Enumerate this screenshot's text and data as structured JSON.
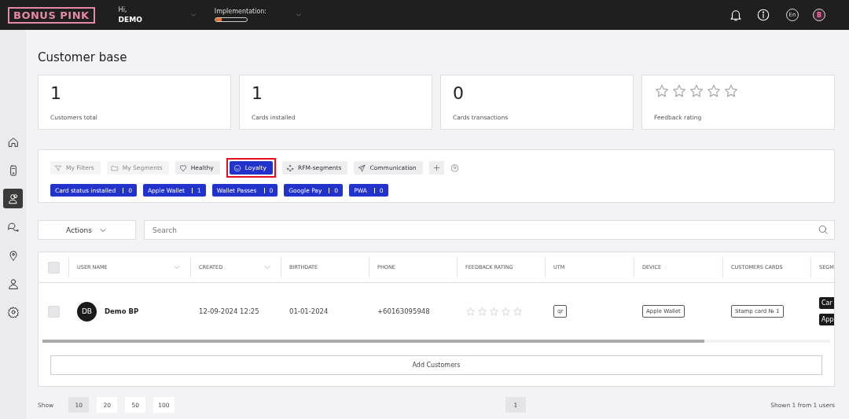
{
  "topbar": {
    "logo": "BONUS PINK",
    "greeting": "Hi,",
    "user": "DEMO",
    "implementation": {
      "label": "Implementation:",
      "level": 0.2
    },
    "language": "En",
    "avatar": "B"
  },
  "sidebar": {
    "items": [
      {
        "selected": false
      },
      {
        "selected": false
      },
      {
        "selected": true
      },
      {
        "selected": false
      },
      {
        "selected": false
      },
      {
        "selected": false
      },
      {
        "selected": false
      }
    ]
  },
  "page_title": "Customer base",
  "stats": [
    {
      "kind": "number",
      "value": "1",
      "label": "Customers total"
    },
    {
      "kind": "number",
      "value": "1",
      "label": "Cards installed"
    },
    {
      "kind": "number",
      "value": "0",
      "label": "Cards transactions"
    },
    {
      "kind": "stars",
      "stars": 0,
      "label": "Feedback rating"
    }
  ],
  "filter_tabs": [
    {
      "label": "My Filters",
      "disabled": true,
      "selected": false,
      "highlighted": false
    },
    {
      "label": "My Segments",
      "disabled": true,
      "selected": false,
      "highlighted": false
    },
    {
      "label": "Healthy",
      "disabled": false,
      "selected": false,
      "highlighted": false
    },
    {
      "label": "Loyalty",
      "disabled": false,
      "selected": true,
      "highlighted": true
    },
    {
      "label": "RFM-segments",
      "disabled": false,
      "selected": false,
      "highlighted": false
    },
    {
      "label": "Communication",
      "disabled": false,
      "selected": false,
      "highlighted": false
    }
  ],
  "chips": [
    {
      "label": "Card status installed",
      "count": "0"
    },
    {
      "label": "Apple Wallet",
      "count": "1"
    },
    {
      "label": "Wallet Passes",
      "count": "0"
    },
    {
      "label": "Google Pay",
      "count": "0"
    },
    {
      "label": "PWA",
      "count": "0"
    }
  ],
  "actions": "Actions",
  "search": {
    "placeholder": "Search"
  },
  "table": {
    "select_all_checked": false,
    "columns": [
      {
        "label": "USER NAME",
        "sortable": true
      },
      {
        "label": "CREATED",
        "sortable": true
      },
      {
        "label": "BIRTHDATE",
        "sortable": false
      },
      {
        "label": "PHONE",
        "sortable": false
      },
      {
        "label": "FEEDBACK RATING",
        "sortable": false
      },
      {
        "label": "UTM",
        "sortable": false
      },
      {
        "label": "DEVICE",
        "sortable": false
      },
      {
        "label": "CUSTOMERS CARDS",
        "sortable": false
      },
      {
        "label": "SEGM"
      }
    ],
    "rows": [
      {
        "checked": false,
        "initials": "DB",
        "name": "Demo BP",
        "created": "12-09-2024 12:25",
        "birthdate": "01-01-2024",
        "phone": "+60163095948",
        "stars": 0,
        "utm": "qr",
        "device": "Apple Wallet",
        "card": "Stamp card № 1",
        "segments": [
          "Car",
          "App"
        ]
      }
    ]
  },
  "add_button": "Add Customers",
  "footer": {
    "show_label": "Show",
    "page_sizes": [
      {
        "label": "10",
        "selected": true
      },
      {
        "label": "20",
        "selected": false
      },
      {
        "label": "50",
        "selected": false
      },
      {
        "label": "100",
        "selected": false
      }
    ],
    "pages": [
      {
        "label": "1",
        "selected": true
      }
    ],
    "summary": "Shown 1 from 1 users"
  }
}
